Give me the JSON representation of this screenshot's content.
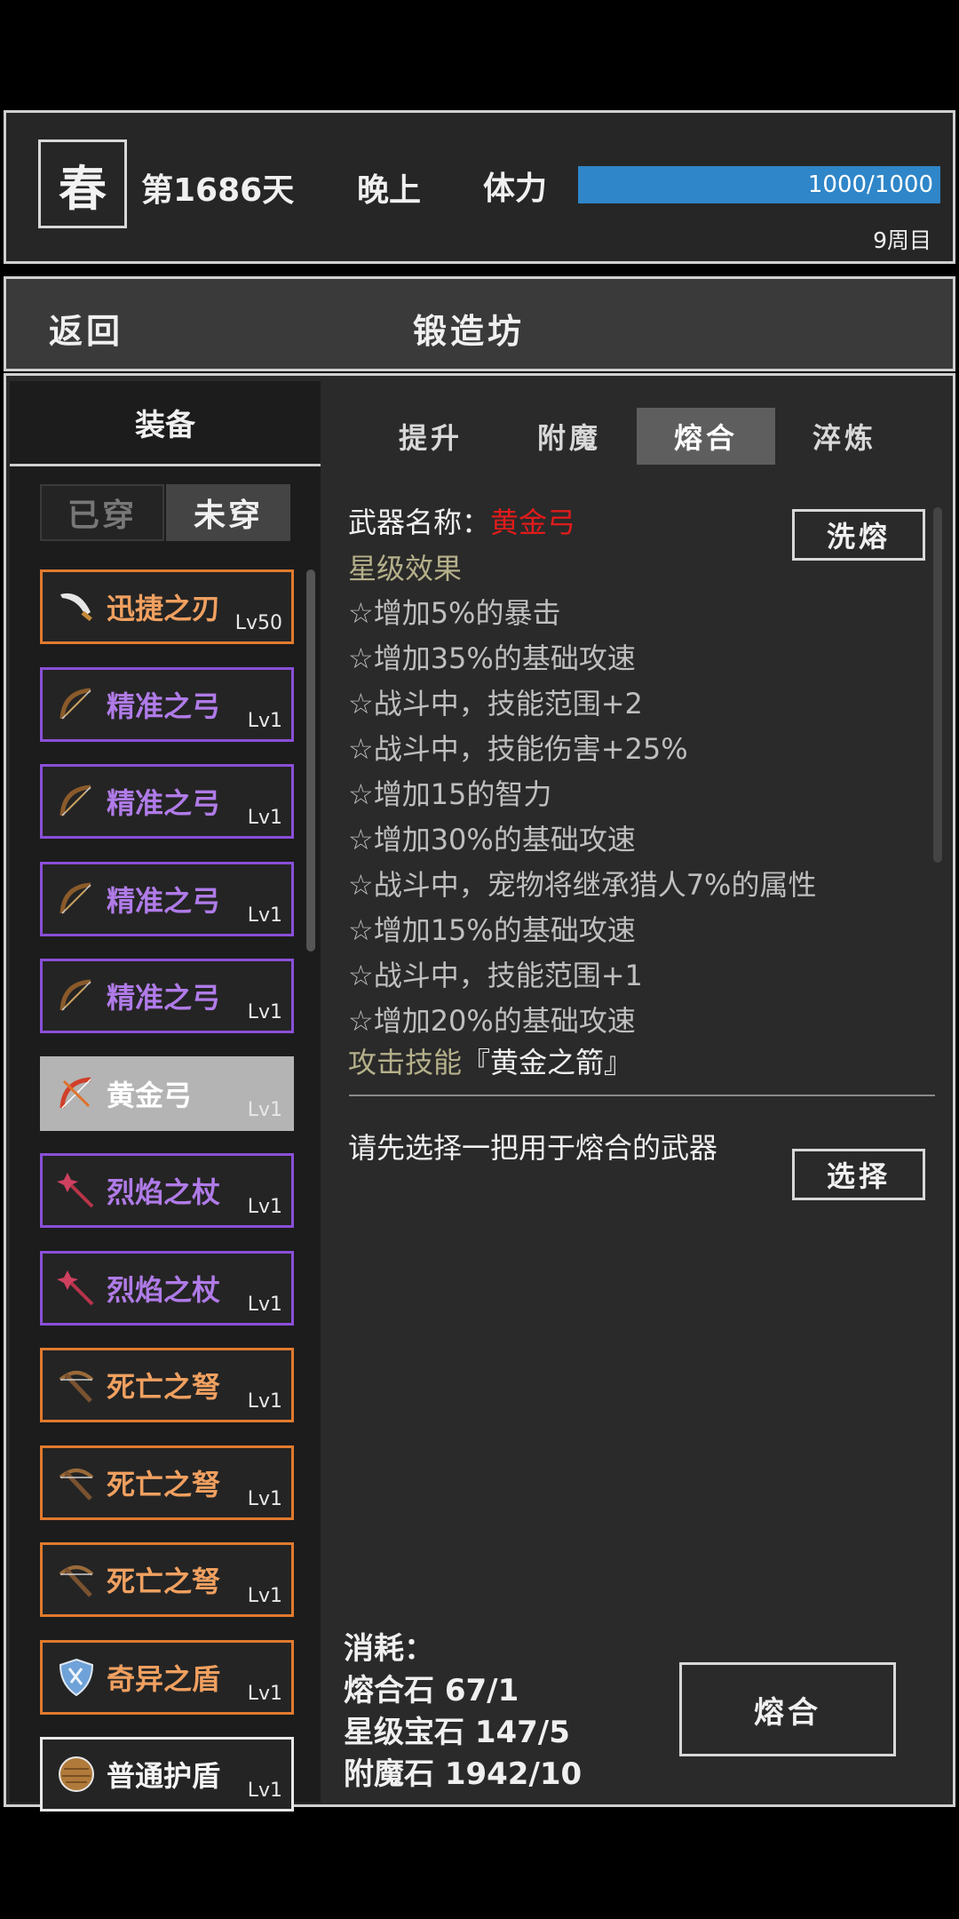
{
  "status": {
    "season": "春",
    "day": "第1686天",
    "time_of_day": "晚上",
    "stamina_label": "体力",
    "stamina_text": "1000/1000",
    "stamina_fraction": 1.0,
    "cycle": "9周目"
  },
  "nav": {
    "back": "返回",
    "title": "锻造坊"
  },
  "left": {
    "header": "装备",
    "filter_tabs": [
      "已穿",
      "未穿"
    ],
    "active_filter": "未穿",
    "items": [
      {
        "name": "迅捷之刃",
        "level": "Lv50",
        "rarity": "orange",
        "icon": "blade-icon"
      },
      {
        "name": "精准之弓",
        "level": "Lv1",
        "rarity": "purple",
        "icon": "bow-icon"
      },
      {
        "name": "精准之弓",
        "level": "Lv1",
        "rarity": "purple",
        "icon": "bow-icon"
      },
      {
        "name": "精准之弓",
        "level": "Lv1",
        "rarity": "purple",
        "icon": "bow-icon"
      },
      {
        "name": "精准之弓",
        "level": "Lv1",
        "rarity": "purple",
        "icon": "bow-icon"
      },
      {
        "name": "黄金弓",
        "level": "Lv1",
        "rarity": "selected",
        "icon": "golden-bow-icon"
      },
      {
        "name": "烈焰之杖",
        "level": "Lv1",
        "rarity": "purple",
        "icon": "staff-icon"
      },
      {
        "name": "烈焰之杖",
        "level": "Lv1",
        "rarity": "purple",
        "icon": "staff-icon"
      },
      {
        "name": "死亡之弩",
        "level": "Lv1",
        "rarity": "orange",
        "icon": "crossbow-icon"
      },
      {
        "name": "死亡之弩",
        "level": "Lv1",
        "rarity": "orange",
        "icon": "crossbow-icon"
      },
      {
        "name": "死亡之弩",
        "level": "Lv1",
        "rarity": "orange",
        "icon": "crossbow-icon"
      },
      {
        "name": "奇异之盾",
        "level": "Lv1",
        "rarity": "orange",
        "icon": "shield-icon"
      },
      {
        "name": "普通护盾",
        "level": "Lv1",
        "rarity": "white",
        "icon": "wooden-shield-icon"
      }
    ]
  },
  "right": {
    "tabs": [
      "提升",
      "附魔",
      "熔合",
      "淬炼"
    ],
    "active_tab": "熔合",
    "weapon_label": "武器名称：",
    "weapon_name": "黄金弓",
    "wash_button": "洗熔",
    "star_header": "星级效果",
    "effects": [
      "☆增加5%的暴击",
      "☆增加35%的基础攻速",
      "☆战斗中，技能范围+2",
      "☆战斗中，技能伤害+25%",
      "☆增加15的智力",
      "☆增加30%的基础攻速",
      "☆战斗中，宠物将继承猎人7%的属性",
      "☆增加15%的基础攻速",
      "☆战斗中，技能范围+1",
      "☆增加20%的基础攻速"
    ],
    "skill_label": "攻击技能",
    "skill_name": "『黄金之箭』",
    "hint": "请先选择一把用于熔合的武器",
    "select_button": "选择",
    "cost_label": "消耗：",
    "costs": [
      "熔合石 67/1",
      "星级宝石 147/5",
      "附魔石 1942/10"
    ],
    "fuse_button": "熔合"
  },
  "colors": {
    "orange": "#e07a2e",
    "purple": "#8a4fd8",
    "accent_blue": "#2f86c8",
    "weapon_red": "#e11b1b"
  }
}
